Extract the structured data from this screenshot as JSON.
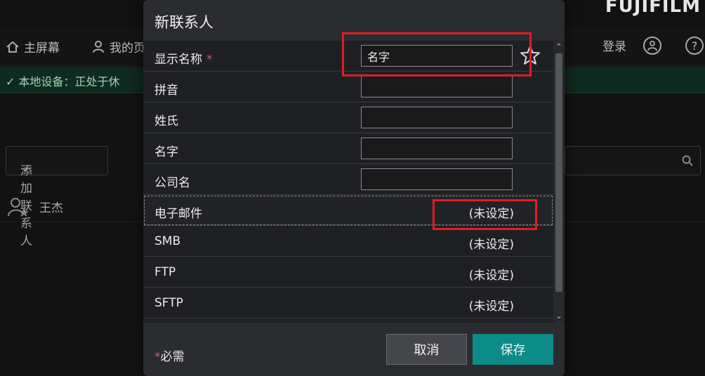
{
  "background": {
    "brand": "FUJIFILM",
    "nav": {
      "home_label": "主屏幕",
      "my_label": "我的页",
      "login_label": "登录"
    },
    "status_text": "本地设备：正处于休",
    "add_contact_dropdown": "添加联系人",
    "contact_name": "王杰"
  },
  "dialog": {
    "title": "新联系人",
    "fields": [
      {
        "label": "显示名称",
        "required": "*",
        "value": "名字"
      },
      {
        "label": "拼音",
        "value": ""
      },
      {
        "label": "姓氏",
        "value": ""
      },
      {
        "label": "名字",
        "value": ""
      },
      {
        "label": "公司名",
        "value": ""
      }
    ],
    "address_rows": [
      {
        "label": "电子邮件",
        "value": "(未设定)"
      },
      {
        "label": "SMB",
        "value": "(未设定)"
      },
      {
        "label": "FTP",
        "value": "(未设定)"
      },
      {
        "label": "SFTP",
        "value": "(未设定)"
      }
    ],
    "required_note_asterisk": "*",
    "required_note_text": "必需",
    "cancel_label": "取消",
    "save_label": "保存"
  },
  "colors": {
    "accent_save": "#0c8b88",
    "highlight_red": "#e11d24",
    "required_red": "#e05050"
  }
}
